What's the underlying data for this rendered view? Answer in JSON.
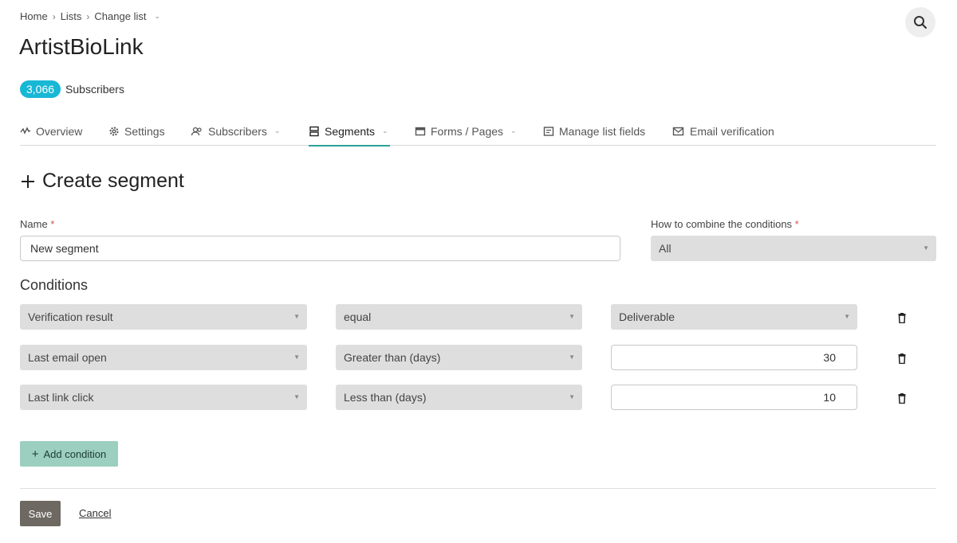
{
  "breadcrumb": {
    "home": "Home",
    "lists": "Lists",
    "current": "Change list"
  },
  "header": {
    "title": "ArtistBioLink",
    "subscriber_count": "3,066",
    "subscriber_label": "Subscribers"
  },
  "tabs": [
    {
      "label": "Overview",
      "icon": "activity-icon"
    },
    {
      "label": "Settings",
      "icon": "gear-icon"
    },
    {
      "label": "Subscribers",
      "icon": "users-icon"
    },
    {
      "label": "Segments",
      "icon": "segments-icon",
      "active": true
    },
    {
      "label": "Forms / Pages",
      "icon": "form-icon"
    },
    {
      "label": "Manage list fields",
      "icon": "fields-icon"
    },
    {
      "label": "Email verification",
      "icon": "mail-check-icon"
    }
  ],
  "form": {
    "section_title": "Create segment",
    "name_label": "Name",
    "name_value": "New segment",
    "combine_label": "How to combine the conditions",
    "combine_value": "All",
    "required_mark": "*",
    "conditions_title": "Conditions",
    "conditions": [
      {
        "field": "Verification result",
        "operator": "equal",
        "value": "Deliverable",
        "value_type": "select"
      },
      {
        "field": "Last email open",
        "operator": "Greater than (days)",
        "value": "30",
        "value_type": "input"
      },
      {
        "field": "Last link click",
        "operator": "Less than (days)",
        "value": "10",
        "value_type": "input"
      }
    ],
    "add_condition_label": "Add condition",
    "save_label": "Save",
    "cancel_label": "Cancel"
  },
  "colors": {
    "accent": "#2aa198",
    "badge": "#17b7d6",
    "add_button": "#9ccfbf",
    "save_button": "#6e6862"
  }
}
